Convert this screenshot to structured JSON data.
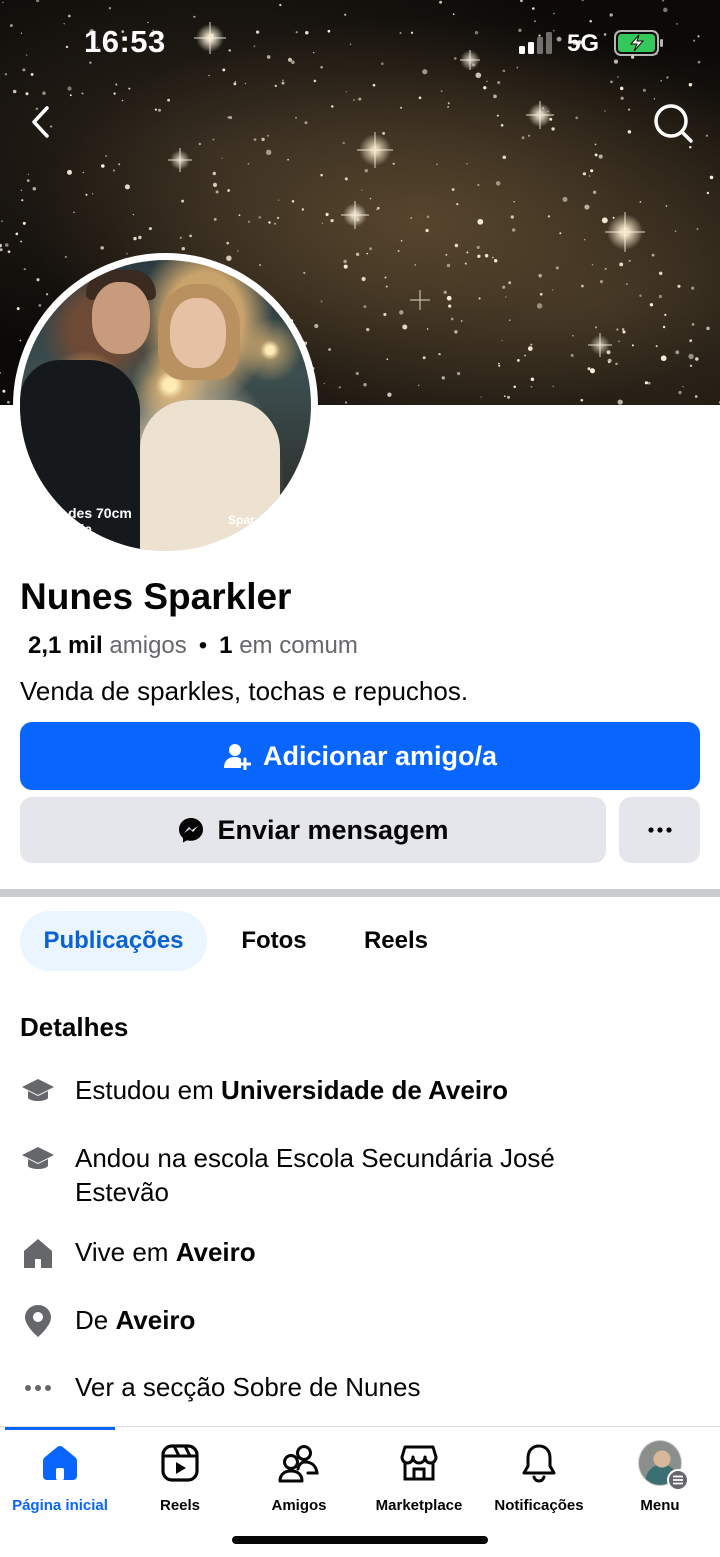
{
  "status_bar": {
    "time": "16:53",
    "network": "5G"
  },
  "profile": {
    "name": "Nunes Sparkler",
    "friends_count": "2,1 mil",
    "friends_label": "amigos",
    "separator": "•",
    "mutual_count": "1",
    "mutual_label": "em comum",
    "bio": "Venda de sparkles, tochas e repuchos.",
    "avatar_caption_left": "des 70cm",
    "avatar_caption_left2": "ada",
    "avatar_caption_right": "Spar"
  },
  "actions": {
    "add_friend": "Adicionar amigo/a",
    "message": "Enviar mensagem",
    "more": "···"
  },
  "tabs": [
    {
      "label": "Publicações",
      "active": true
    },
    {
      "label": "Fotos",
      "active": false
    },
    {
      "label": "Reels",
      "active": false
    }
  ],
  "details": {
    "title": "Detalhes",
    "items": [
      {
        "icon": "graduation-cap-icon",
        "prefix": "Estudou em ",
        "bold": "Universidade de Aveiro"
      },
      {
        "icon": "graduation-cap-icon",
        "prefix": "Andou na escola Escola Secundária José Estevão",
        "bold": ""
      },
      {
        "icon": "house-icon",
        "prefix": "Vive em ",
        "bold": "Aveiro"
      },
      {
        "icon": "location-pin-icon",
        "prefix": "De ",
        "bold": "Aveiro"
      },
      {
        "icon": "more-dots-icon",
        "prefix": "Ver a secção Sobre de Nunes",
        "bold": ""
      }
    ]
  },
  "bottom_nav": [
    {
      "label": "Página inicial",
      "icon": "home-icon",
      "active": true
    },
    {
      "label": "Reels",
      "icon": "reels-icon",
      "active": false
    },
    {
      "label": "Amigos",
      "icon": "friends-icon",
      "active": false
    },
    {
      "label": "Marketplace",
      "icon": "marketplace-icon",
      "active": false
    },
    {
      "label": "Notificações",
      "icon": "bell-icon",
      "active": false
    },
    {
      "label": "Menu",
      "icon": "menu-avatar",
      "active": false
    }
  ],
  "colors": {
    "primary": "#0866ff",
    "secondary_button": "#e4e6eb",
    "active_tab_bg": "#ebf5ff",
    "active_tab_text": "#0a63d5"
  }
}
